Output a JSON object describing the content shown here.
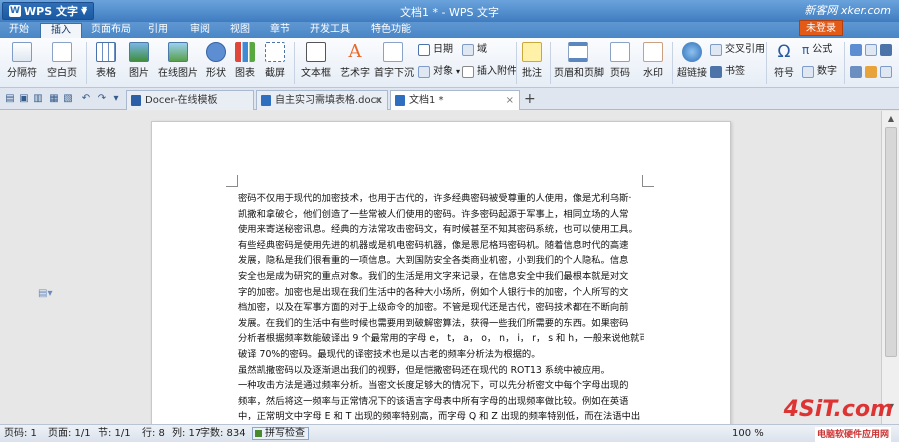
{
  "window": {
    "app_button": "WPS 文字",
    "title": "文档1 * - WPS 文字",
    "watermark": "新客网 xker.com",
    "login": "未登录"
  },
  "menu_tabs": [
    "开始",
    "插入",
    "页面布局",
    "引用",
    "审阅",
    "视图",
    "章节",
    "开发工具",
    "特色功能"
  ],
  "active_menu": "插入",
  "ribbon": {
    "pagebreak": "分隔符",
    "blankpage": "空白页",
    "table": "表格",
    "picture": "图片",
    "online_picture": "在线图片",
    "shape": "形状",
    "chart": "图表",
    "screenshot": "截屏",
    "textbox": "文本框",
    "wordart": "艺术字",
    "dropcap": "首字下沉",
    "date": "日期",
    "field": "域",
    "object": "对象",
    "attach": "插入附件",
    "comment": "批注",
    "header_footer": "页眉和页脚",
    "page_number": "页码",
    "watermark": "水印",
    "hyperlink": "超链接",
    "crossref": "交叉引用",
    "bookmark": "书签",
    "symbol": "符号",
    "formula": "公式",
    "number": "数字"
  },
  "doc_tabs": [
    {
      "label": "Docer-在线模板"
    },
    {
      "label": "自主实习需填表格.docx"
    },
    {
      "label": "文档1 *"
    }
  ],
  "document": {
    "lines": [
      "密码不仅用于现代的加密技术，也用于古代的，许多经典密码被受尊重的人使用，像是尤利乌斯·",
      "凯撒和拿破仑，他们创造了一些常被人们使用的密码。许多密码起源于军事上，相同立场的人常",
      "使用来寄送秘密讯息。经典的方法常攻击密码文，有时候甚至不知其密码系统，也可以使用工具。",
      "有些经典密码是使用先进的机器或是机电密码机器，像是恩尼格玛密码机。随着信息时代的高速",
      "发展，隐私是我们很看重的一项信息。大到国防安全各类商业机密，小到我们的个人隐私。信息",
      "安全也是成为研究的重点对象。我们的生活是用文字来记录，在信息安全中我们最根本就是对文",
      "字的加密。加密也是出现在我们生活中的各种大小场所，例如个人银行卡的加密，个人所写的文",
      "档加密，以及在军事方面的对于上级命令的加密。不管是现代还是古代，密码技术都在不断向前",
      "发展。在我们的生活中有些时候也需要用到破解密算法，获得一些我们所需要的东西。如果密码",
      "分析者根据频率数能破译出 9 个最常用的字母 e， t， a， o， n， i， r， s 和 h，一般来说他就可",
      "破译 70%的密码。最现代的译密技术也是以古老的频率分析法为根据的。",
      "虽然凯撒密码以及逐渐退出我们的视野，但是恺撒密码还在现代的 ROT13 系统中被应用。",
      "一种攻击方法是通过频率分析。当密文长度足够大的情况下，可以先分析密文中每个字母出现的",
      "频率，然后将这一频率与正常情况下的该语言字母表中所有字母的出现频率做比较。例如在英语",
      "中，正常明文中字母 E 和 T 出现的频率特别高，而字母 Q 和 Z 出现的频率特别低，而在法语中出"
    ]
  },
  "status": {
    "page": "页码: 1",
    "pages": "页面: 1/1",
    "section": "节: 1/1",
    "row": "行: 8",
    "col": "列: 17",
    "words": "字数: 834",
    "spell": "拼写检查",
    "zoom": "100 %"
  },
  "branding": {
    "logo": "4SiT.com",
    "sub": "电脑软硬件应用网"
  }
}
